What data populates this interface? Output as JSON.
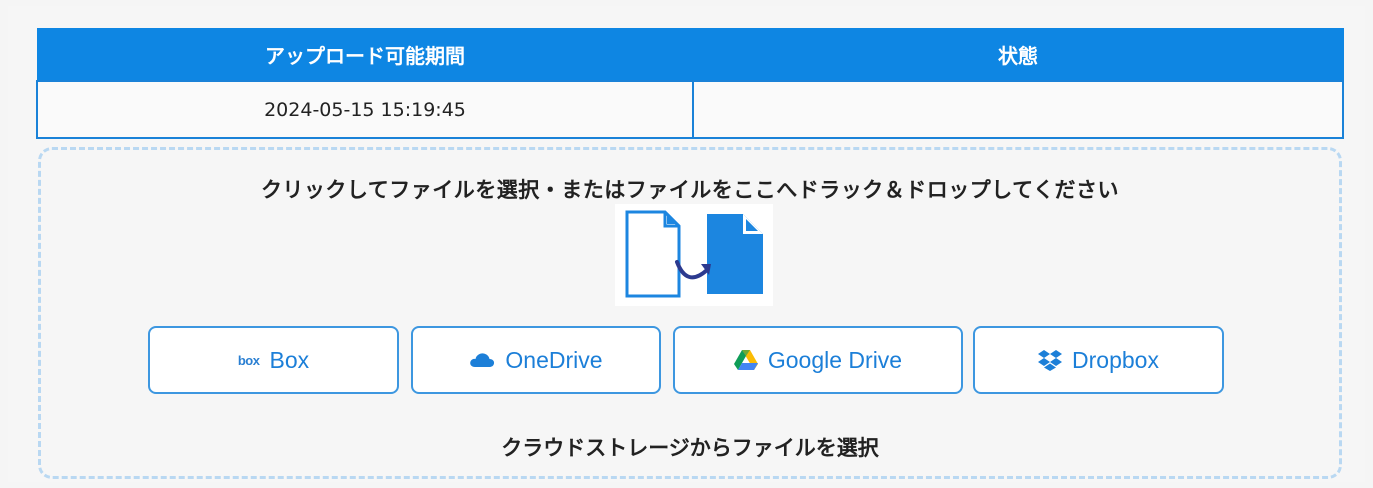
{
  "table": {
    "headers": [
      "アップロード可能期間",
      "状態"
    ],
    "row": {
      "period": "2024-05-15 15:19:45",
      "status": ""
    }
  },
  "dropzone": {
    "instruction": "クリックしてファイルを選択・またはファイルをここへドラック＆ドロップしてください",
    "graphic_icon": "file-transfer-icon"
  },
  "cloud": {
    "buttons": [
      {
        "label": "Box",
        "icon": "box-icon"
      },
      {
        "label": "OneDrive",
        "icon": "onedrive-icon"
      },
      {
        "label": "Google Drive",
        "icon": "google-drive-icon"
      },
      {
        "label": "Dropbox",
        "icon": "dropbox-icon"
      }
    ],
    "box_logo_text": "box",
    "caption": "クラウドストレージからファイルを選択"
  },
  "colors": {
    "accent": "#0e86e3",
    "button_border": "#3d97e0",
    "dropzone_border": "#b9d8f2",
    "arrow": "#2c3a8f"
  }
}
